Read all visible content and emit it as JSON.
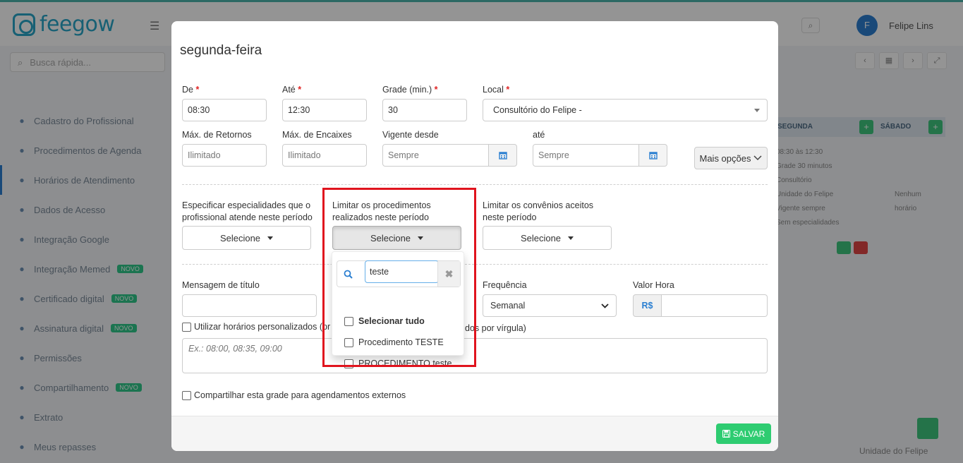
{
  "background": {
    "logo_text": "feegow",
    "user_initial": "F",
    "user_name": "Felipe Lins",
    "quick_search_placeholder": "Busca rápida...",
    "sidebar": [
      {
        "label": "Cadastro do Profissional",
        "icon": "user-icon",
        "badge": ""
      },
      {
        "label": "Procedimentos de Agenda",
        "icon": "list-icon",
        "badge": ""
      },
      {
        "label": "Horários de Atendimento",
        "icon": "clock-icon",
        "badge": ""
      },
      {
        "label": "Dados de Acesso",
        "icon": "key-icon",
        "badge": ""
      },
      {
        "label": "Integração Google",
        "icon": "google-icon",
        "badge": ""
      },
      {
        "label": "Integração Memed",
        "icon": "pill-icon",
        "badge": "NOVO"
      },
      {
        "label": "Certificado digital",
        "icon": "certificate-icon",
        "badge": "NOVO"
      },
      {
        "label": "Assinatura digital",
        "icon": "signature-icon",
        "badge": "NOVO"
      },
      {
        "label": "Permissões",
        "icon": "lock-icon",
        "badge": ""
      },
      {
        "label": "Compartilhamento",
        "icon": "share-icon",
        "badge": "NOVO"
      },
      {
        "label": "Extrato",
        "icon": "receipt-icon",
        "badge": ""
      },
      {
        "label": "Meus repasses",
        "icon": "money-icon",
        "badge": ""
      }
    ],
    "right_head_1": "SEGUNDA",
    "right_head_2": "SÁBADO",
    "right_lines": [
      "08:30 às 12:30",
      "Grade 30 minutos",
      "Consultório",
      "Unidade do Felipe",
      "Vigente sempre",
      "Sem especialidades"
    ],
    "right_col2": [
      "Nenhum",
      "horário"
    ],
    "bottom_text": "Unidade do Felipe"
  },
  "modal": {
    "title": "segunda-feira",
    "de": {
      "label": "De",
      "value": "08:30"
    },
    "ate": {
      "label": "Até",
      "value": "12:30"
    },
    "grade": {
      "label": "Grade (min.)",
      "value": "30"
    },
    "local": {
      "label": "Local",
      "value": "Consultório do Felipe -"
    },
    "max_retornos": {
      "label": "Máx. de Retornos",
      "placeholder": "Ilimitado"
    },
    "max_encaixes": {
      "label": "Máx. de Encaixes",
      "placeholder": "Ilimitado"
    },
    "vigente_desde": {
      "label": "Vigente desde",
      "placeholder": "Sempre"
    },
    "vigente_ate": {
      "label": "até",
      "placeholder": "Sempre"
    },
    "mais_opcoes": "Mais opções",
    "especialidades": {
      "label": "Especificar especialidades que o profissional atende neste período",
      "button": "Selecione"
    },
    "procedimentos": {
      "label": "Limitar os procedimentos realizados neste período",
      "button": "Selecione",
      "search_value": "teste",
      "options": [
        "Selecionar tudo",
        "Procedimento TESTE",
        "PROCEDIMENTO teste"
      ]
    },
    "convenios": {
      "label": "Limitar os convênios aceitos neste período",
      "button": "Selecione"
    },
    "mensagem_titulo": {
      "label": "Mensagem de título",
      "value": ""
    },
    "frequencia": {
      "label": "Frequência",
      "value": "Semanal"
    },
    "valor_hora": {
      "label": "Valor Hora",
      "currency": "R$",
      "value": ""
    },
    "horarios_personalizados": {
      "label_left": "Utilizar horários personalizados (pr",
      "label_right": "dos por vírgula)",
      "placeholder": "Ex.: 08:00, 08:35, 09:00"
    },
    "compartilhar": "Compartilhar esta grade para agendamentos externos",
    "save_button": "SALVAR"
  }
}
